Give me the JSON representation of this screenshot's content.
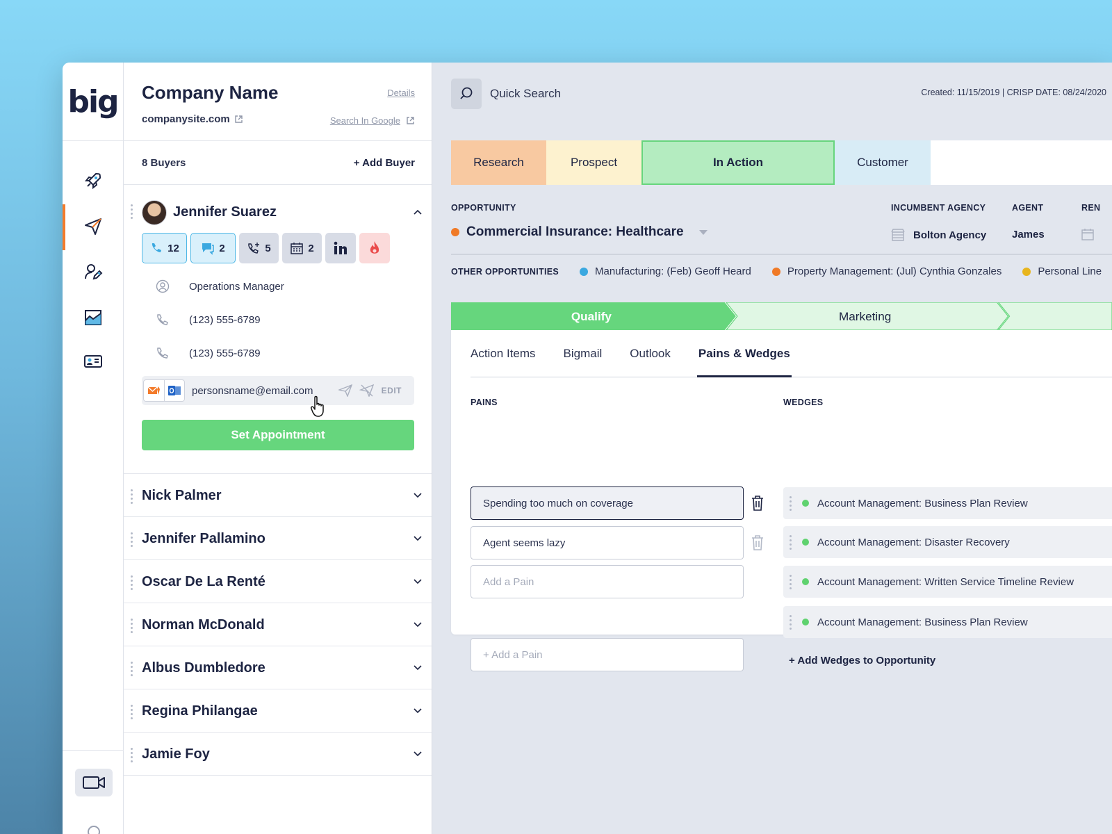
{
  "app": {
    "logo": "big"
  },
  "rail": {
    "icons": [
      "rocket-icon",
      "send-icon",
      "user-edit-icon",
      "chart-icon",
      "contact-card-icon",
      "video-icon"
    ]
  },
  "company": {
    "name": "Company Name",
    "site": "companysite.com",
    "details_link": "Details",
    "google_link": "Search In Google"
  },
  "buyers": {
    "count_label": "8 Buyers",
    "add_label": "+ Add Buyer",
    "open": {
      "name": "Jennifer Suarez",
      "badges": [
        {
          "icon": "phone-icon",
          "count": "12"
        },
        {
          "icon": "chat-icon",
          "count": "2"
        },
        {
          "icon": "phone-plus-icon",
          "count": "5"
        },
        {
          "icon": "calendar-icon",
          "count": "2"
        },
        {
          "icon": "linkedin-icon",
          "count": ""
        },
        {
          "icon": "flame-icon",
          "count": ""
        }
      ],
      "title": "Operations Manager",
      "phone1": "(123) 555-6789",
      "phone2": "(123) 555-6789",
      "email": "personsname@email.com",
      "edit_label": "EDIT",
      "set_appointment": "Set Appointment"
    },
    "collapsed": [
      "Nick Palmer",
      "Jennifer Pallamino",
      "Oscar De La Renté",
      "Norman McDonald",
      "Albus Dumbledore",
      "Regina Philangae",
      "Jamie Foy"
    ]
  },
  "main": {
    "search_label": "Quick Search",
    "created": "Created: 11/15/2019 | CRISP DATE: 08/24/2020",
    "stages": [
      "Research",
      "Prospect",
      "In Action",
      "Customer"
    ],
    "active_stage": "In Action",
    "opportunity_label": "OPPORTUNITY",
    "opportunity": "Commercial Insurance: Healthcare",
    "incumbent_label": "INCUMBENT AGENCY",
    "incumbent": "Bolton Agency",
    "agent_label": "AGENT",
    "agent": "James",
    "renewal_label": "REN",
    "other_label": "OTHER OPPORTUNITIES",
    "other_opportunities": [
      {
        "label": "Manufacturing: (Feb) Geoff Heard",
        "color": "#3aa8e0"
      },
      {
        "label": "Property Management: (Jul) Cynthia Gonzales",
        "color": "#f07a26"
      },
      {
        "label": "Personal Line",
        "color": "#e8b51d"
      }
    ],
    "pipeline": [
      "Qualify",
      "Marketing"
    ],
    "tabs": [
      "Action Items",
      "Bigmail",
      "Outlook",
      "Pains & Wedges"
    ],
    "active_tab": "Pains & Wedges",
    "pains_label": "PAINS",
    "pains": [
      "Spending too much on coverage",
      "Agent seems lazy"
    ],
    "add_pain_placeholder": "Add a Pain",
    "add_pain_button": "+ Add a Pain",
    "wedges_label": "WEDGES",
    "wedges": [
      "Account Management: Business Plan Review",
      "Account Management: Disaster Recovery",
      "Account Management: Written Service Timeline Review",
      "Account Management: Business Plan Review"
    ],
    "add_wedges": "+ Add Wedges to Opportunity"
  },
  "colors": {
    "accent_orange": "#f37b2b",
    "green": "#66d67d",
    "navy": "#1d2442"
  }
}
